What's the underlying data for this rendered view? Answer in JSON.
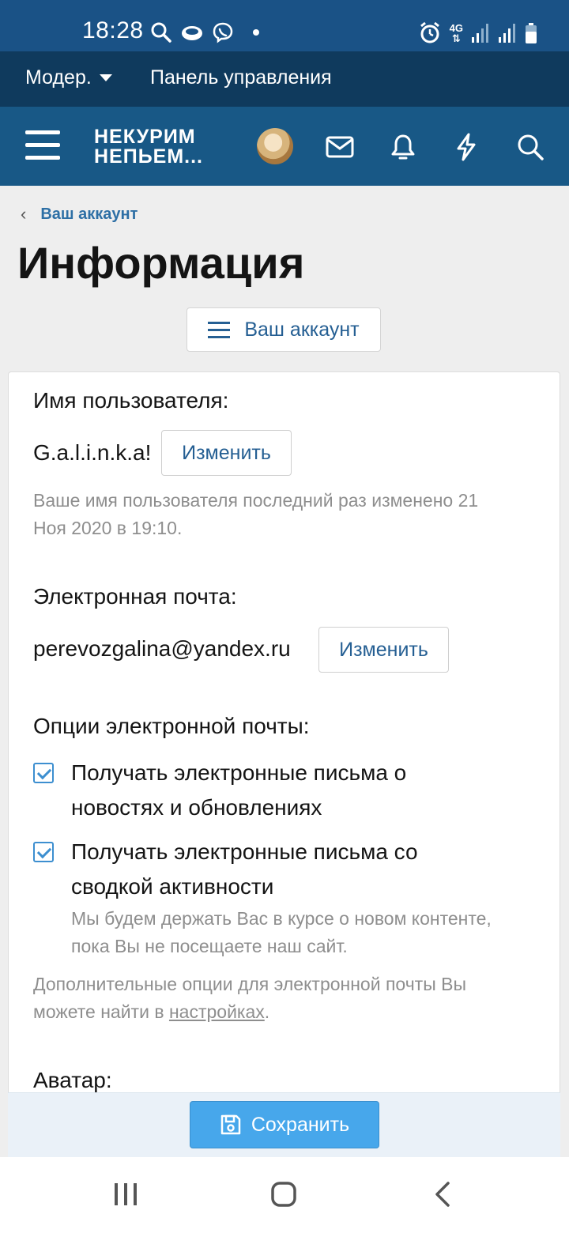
{
  "status_bar": {
    "time": "18:28",
    "network": "4G"
  },
  "mod_bar": {
    "moderator_label": "Модер.",
    "panel_label": "Панель управления"
  },
  "header": {
    "logo_line1": "НЕКУРИМ",
    "logo_line2": "НЕПЬЕМ..."
  },
  "breadcrumb": {
    "label": "Ваш аккаунт"
  },
  "page_title": "Информация",
  "account_menu_button": "Ваш аккаунт",
  "form": {
    "username_label": "Имя пользователя:",
    "username_value": "G.a.l.i.n.k.a!",
    "change_label": "Изменить",
    "username_hint_line1": "Ваше имя пользователя последний раз изменено 21",
    "username_hint_line2": "Ноя 2020 в 19:10.",
    "email_label": "Электронная почта:",
    "email_value": "perevozgalina@yandex.ru",
    "email_options_label": "Опции электронной почты:",
    "options": [
      {
        "line1": "Получать электронные письма о",
        "line2": "новостях и обновлениях",
        "checked": true
      },
      {
        "line1": "Получать электронные письма со",
        "line2": "сводкой активности",
        "checked": true
      }
    ],
    "activity_hint_line1": "Мы будем держать Вас в курсе о новом контенте,",
    "activity_hint_line2": "пока Вы не посещаете наш сайт.",
    "more_options_line1": "Дополнительные опции для электронной почты Вы",
    "more_options_prefix": "можете найти в ",
    "more_options_link": "настройках",
    "more_options_suffix": ".",
    "avatar_label": "Аватар:"
  },
  "save_button": "Сохранить",
  "colors": {
    "status_bar": "#1a5286",
    "mod_bar": "#0f3a5d",
    "header": "#185886",
    "accent": "#255f93",
    "save_button": "#47a7eb"
  }
}
